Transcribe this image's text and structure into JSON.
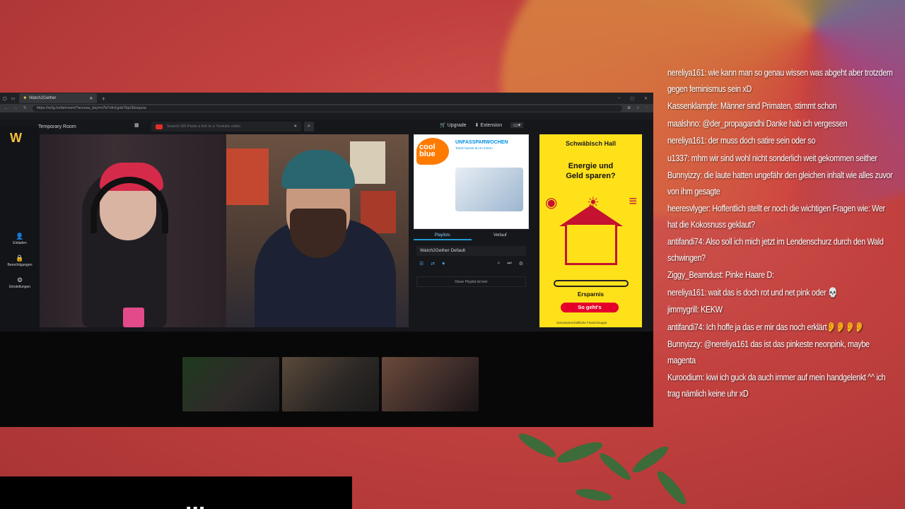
{
  "browser": {
    "tab_title": "Watch2Gether",
    "url": "https://w2g.tv/de/room/?access_key=o7b7ofn1gob7bp18zzqzza"
  },
  "app": {
    "logo": "W",
    "room_name": "Temporary Room",
    "search_placeholder": "Search OR Paste a link to a Youtube video",
    "upgrade_label": "Upgrade",
    "extension_label": "Extension",
    "sidebar": [
      {
        "label": "Einladen",
        "icon": "add-user-icon"
      },
      {
        "label": "Berechtigungen",
        "icon": "lock-icon"
      },
      {
        "label": "Einstellungen",
        "icon": "gear-icon"
      }
    ],
    "playlist": {
      "tabs": [
        "Playlists",
        "Verlauf"
      ],
      "active_tab": "Playlists",
      "name": "Watch2Gether Default",
      "empty_text": "Diese Playlist ist leer"
    }
  },
  "ads": {
    "coolblue": {
      "brand": "cool blue",
      "title": "UNFASSPARWOCHEN",
      "subtitle": "Tanze kannst du im Innern"
    },
    "schwaebisch_hall": {
      "brand": "Schwäbisch Hall",
      "headline": "Energie und Geld sparen?",
      "bar_label": "Ersparnis",
      "cta": "So geht's",
      "footer": "Genossenschaftliche FinanzGruppe"
    }
  },
  "overlay_text": "...",
  "chat": [
    {
      "user": "nereliya161",
      "text": "wie kann man so genau wissen was abgeht aber trotzdem gegen feminismus sein xD"
    },
    {
      "user": "Kassenklampfe",
      "text": "Männer sind Primaten, stimmt schon"
    },
    {
      "user": "maalshno",
      "text": "@der_propagandhi Danke hab ich vergessen"
    },
    {
      "user": "nereliya161",
      "text": "der muss doch satire sein oder so"
    },
    {
      "user": "u1337",
      "text": "mhm wir sind wohl nicht sonderlich weit gekommen seither"
    },
    {
      "user": "Bunnyizzy",
      "text": "die laute hatten ungefähr den gleichen inhalt wie alles zuvor von ihm gesagte"
    },
    {
      "user": "heeresvlyger",
      "text": "Hoffentlich stellt er noch die wichtigen Fragen wie: Wer hat die Kokosnuss geklaut?"
    },
    {
      "user": "antifandi74",
      "text": "Also soll ich mich jetzt im Lendenschurz durch den Wald schwingen?"
    },
    {
      "user": "Ziggy_Beamdust",
      "text": "Pinke Haare D:"
    },
    {
      "user": "nereliya161",
      "text": "wait das is doch rot und net pink oder 💀"
    },
    {
      "user": "jimmygrill",
      "text": "KEKW"
    },
    {
      "user": "antifandi74",
      "text": "Ich hoffe ja das er mir das noch erklärt👂👂👂👂"
    },
    {
      "user": "Bunnyizzy",
      "text": "@nereliya161 das ist das pinkeste neonpink, maybe magenta"
    },
    {
      "user": "Kuroodium",
      "text": "kiwi ich guck da auch immer auf mein handgelenkt ^^ ich trag nämlich keine uhr xD"
    }
  ]
}
